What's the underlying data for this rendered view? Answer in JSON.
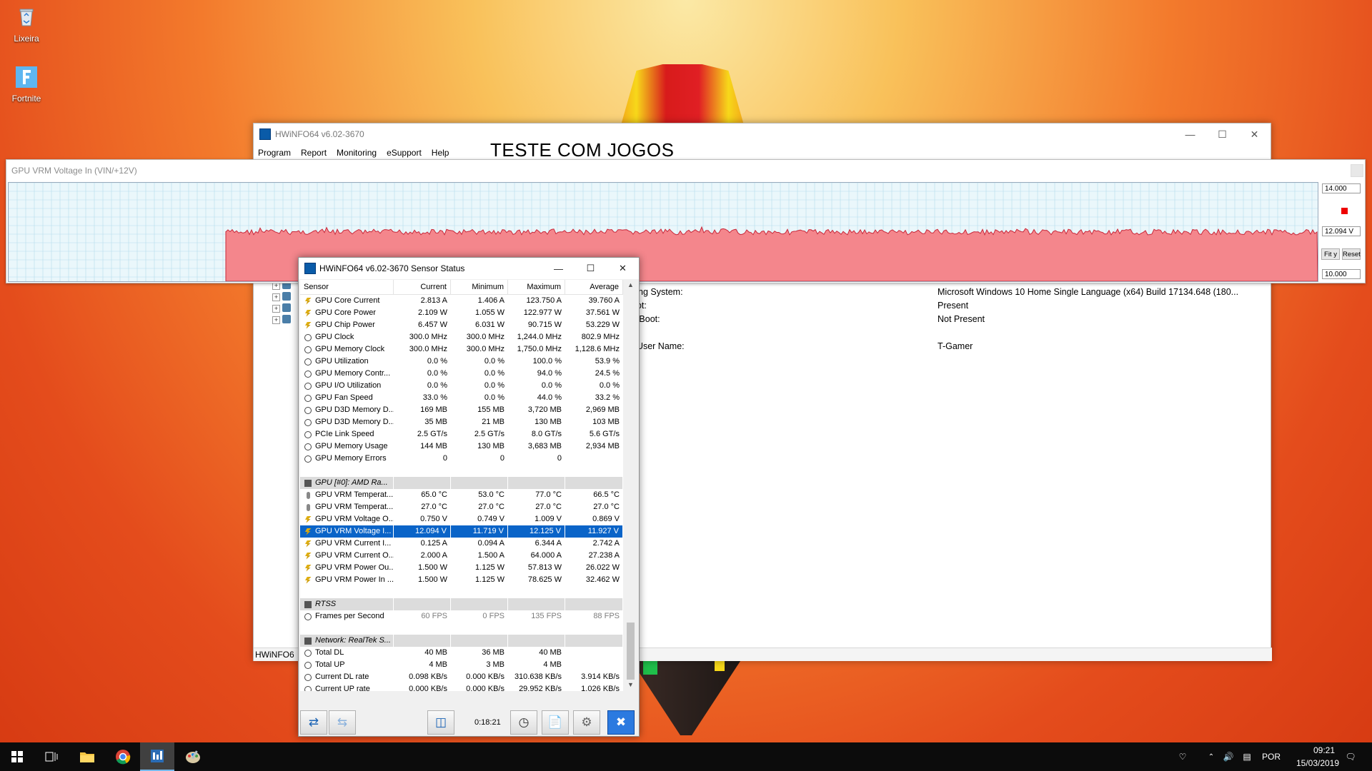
{
  "desktop": {
    "icons": [
      {
        "label": "Lixeira",
        "icon": "recycle-bin-icon"
      },
      {
        "label": "Fortnite",
        "icon": "fortnite-icon"
      }
    ]
  },
  "main_window": {
    "title": "HWiNFO64 v6.02-3670",
    "menu": [
      "Program",
      "Report",
      "Monitoring",
      "eSupport",
      "Help"
    ],
    "overlay_text": "TESTE COM JOGOS",
    "info_rows": [
      {
        "label": "cing System:",
        "value": "Microsoft Windows 10 Home Single Language (x64) Build 17134.648 (180..."
      },
      {
        "label": "oot:",
        "value": "Present"
      },
      {
        "label": "e Boot:",
        "value": "Not Present"
      },
      {
        "label": "t User Name:",
        "value": "T-Gamer"
      }
    ],
    "status_text": "HWiNFO6"
  },
  "graph_window": {
    "title": "GPU VRM Voltage In (VIN/+12V)",
    "max_label": "14.000",
    "current_label": "12.094 V",
    "min_label": "10.000",
    "fit_label": "Fit y",
    "reset_label": "Reset",
    "plot_color": "#f4868c",
    "grid_color": "#b6dced"
  },
  "sensor_window": {
    "title": "HWiNFO64 v6.02-3670 Sensor Status",
    "columns": [
      "Sensor",
      "Current",
      "Minimum",
      "Maximum",
      "Average"
    ],
    "rows": [
      {
        "icon": "bolt",
        "name": "GPU Core Current",
        "cur": "2.813 A",
        "min": "1.406 A",
        "max": "123.750 A",
        "avg": "39.760 A"
      },
      {
        "icon": "bolt",
        "name": "GPU Core Power",
        "cur": "2.109 W",
        "min": "1.055 W",
        "max": "122.977 W",
        "avg": "37.561 W"
      },
      {
        "icon": "bolt",
        "name": "GPU Chip Power",
        "cur": "6.457 W",
        "min": "6.031 W",
        "max": "90.715 W",
        "avg": "53.229 W"
      },
      {
        "icon": "clock",
        "name": "GPU Clock",
        "cur": "300.0 MHz",
        "min": "300.0 MHz",
        "max": "1,244.0 MHz",
        "avg": "802.9 MHz"
      },
      {
        "icon": "clock",
        "name": "GPU Memory Clock",
        "cur": "300.0 MHz",
        "min": "300.0 MHz",
        "max": "1,750.0 MHz",
        "avg": "1,128.6 MHz"
      },
      {
        "icon": "clock",
        "name": "GPU Utilization",
        "cur": "0.0 %",
        "min": "0.0 %",
        "max": "100.0 %",
        "avg": "53.9 %"
      },
      {
        "icon": "clock",
        "name": "GPU Memory Contr...",
        "cur": "0.0 %",
        "min": "0.0 %",
        "max": "94.0 %",
        "avg": "24.5 %"
      },
      {
        "icon": "clock",
        "name": "GPU I/O Utilization",
        "cur": "0.0 %",
        "min": "0.0 %",
        "max": "0.0 %",
        "avg": "0.0 %"
      },
      {
        "icon": "clock",
        "name": "GPU Fan Speed",
        "cur": "33.0 %",
        "min": "0.0 %",
        "max": "44.0 %",
        "avg": "33.2 %"
      },
      {
        "icon": "clock",
        "name": "GPU D3D Memory D...",
        "cur": "169 MB",
        "min": "155 MB",
        "max": "3,720 MB",
        "avg": "2,969 MB"
      },
      {
        "icon": "clock",
        "name": "GPU D3D Memory D...",
        "cur": "35 MB",
        "min": "21 MB",
        "max": "130 MB",
        "avg": "103 MB"
      },
      {
        "icon": "clock",
        "name": "PCIe Link Speed",
        "cur": "2.5 GT/s",
        "min": "2.5 GT/s",
        "max": "8.0 GT/s",
        "avg": "5.6 GT/s"
      },
      {
        "icon": "clock",
        "name": "GPU Memory Usage",
        "cur": "144 MB",
        "min": "130 MB",
        "max": "3,683 MB",
        "avg": "2,934 MB"
      },
      {
        "icon": "clock",
        "name": "GPU Memory Errors",
        "cur": "0",
        "min": "0",
        "max": "0",
        "avg": ""
      },
      {
        "type": "spacer"
      },
      {
        "type": "header",
        "icon": "chip",
        "name": "GPU [#0]: AMD Ra..."
      },
      {
        "icon": "temp",
        "name": "GPU VRM Temperat...",
        "cur": "65.0 °C",
        "min": "53.0 °C",
        "max": "77.0 °C",
        "avg": "66.5 °C"
      },
      {
        "icon": "temp",
        "name": "GPU VRM Temperat...",
        "cur": "27.0 °C",
        "min": "27.0 °C",
        "max": "27.0 °C",
        "avg": "27.0 °C"
      },
      {
        "icon": "bolt",
        "name": "GPU VRM Voltage O...",
        "cur": "0.750 V",
        "min": "0.749 V",
        "max": "1.009 V",
        "avg": "0.869 V"
      },
      {
        "icon": "bolt",
        "name": "GPU VRM Voltage I...",
        "cur": "12.094 V",
        "min": "11.719 V",
        "max": "12.125 V",
        "avg": "11.927 V",
        "selected": true
      },
      {
        "icon": "bolt",
        "name": "GPU VRM Current I...",
        "cur": "0.125 A",
        "min": "0.094 A",
        "max": "6.344 A",
        "avg": "2.742 A"
      },
      {
        "icon": "bolt",
        "name": "GPU VRM Current O...",
        "cur": "2.000 A",
        "min": "1.500 A",
        "max": "64.000 A",
        "avg": "27.238 A"
      },
      {
        "icon": "bolt",
        "name": "GPU VRM Power Ou...",
        "cur": "1.500 W",
        "min": "1.125 W",
        "max": "57.813 W",
        "avg": "26.022 W"
      },
      {
        "icon": "bolt",
        "name": "GPU VRM Power In ...",
        "cur": "1.500 W",
        "min": "1.125 W",
        "max": "78.625 W",
        "avg": "32.462 W"
      },
      {
        "type": "spacer"
      },
      {
        "type": "header",
        "icon": "chip",
        "name": "RTSS"
      },
      {
        "icon": "clock",
        "name": "Frames per Second",
        "cur": "60 FPS",
        "min": "0 FPS",
        "max": "135 FPS",
        "avg": "88 FPS",
        "dim": true
      },
      {
        "type": "spacer"
      },
      {
        "type": "header",
        "icon": "chip",
        "name": "Network: RealTek S..."
      },
      {
        "icon": "clock",
        "name": "Total DL",
        "cur": "40 MB",
        "min": "36 MB",
        "max": "40 MB",
        "avg": ""
      },
      {
        "icon": "clock",
        "name": "Total UP",
        "cur": "4 MB",
        "min": "3 MB",
        "max": "4 MB",
        "avg": ""
      },
      {
        "icon": "clock",
        "name": "Current DL rate",
        "cur": "0.098 KB/s",
        "min": "0.000 KB/s",
        "max": "310.638 KB/s",
        "avg": "3.914 KB/s"
      },
      {
        "icon": "clock",
        "name": "Current UP rate",
        "cur": "0.000 KB/s",
        "min": "0.000 KB/s",
        "max": "29.952 KB/s",
        "avg": "1.026 KB/s"
      }
    ],
    "timer": "0:18:21"
  },
  "taskbar": {
    "language": "POR",
    "time": "09:21",
    "date": "15/03/2019"
  }
}
